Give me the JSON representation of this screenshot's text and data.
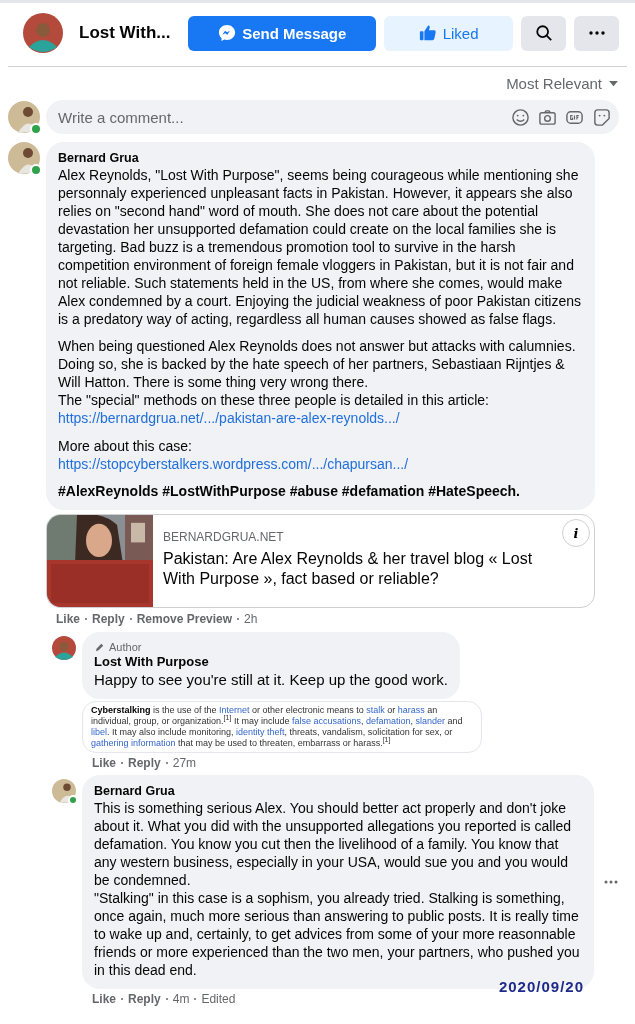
{
  "header": {
    "page_name": "Lost With...",
    "buttons": [
      {
        "label": "Send Message",
        "kind": "primary"
      },
      {
        "label": "Liked",
        "kind": "liked"
      },
      {
        "kind": "search"
      },
      {
        "kind": "more"
      }
    ]
  },
  "sort": {
    "label": "Most Relevant"
  },
  "composer": {
    "placeholder": "Write a comment...",
    "online": true
  },
  "comment": {
    "author": "Bernard Grua",
    "online": true,
    "paragraphs": [
      {
        "lines": [
          {
            "kind": "text",
            "text": "Alex Reynolds, \"Lost With Purpose\", seems being courageous while mentioning she personnaly experienced unpleasant facts in Pakistan. However, it appears she also relies on \"second hand\" word of mouth. She does not care about the potential devastation her unsupported defamation could create on the local families she is targeting. Bad buzz is a tremendous promotion tool to survive in the harsh competition environment of foreign female vloggers in Pakistan, but it is not fair and not reliable. Such statements held in the US, from where she comes, would make Alex condemned by a court. Enjoying the judicial weakness of poor Pakistan citizens is a predatory way of acting, regardless all human causes showed as false flags."
          }
        ]
      },
      {
        "lines": [
          {
            "kind": "text",
            "text": "When being questioned Alex Reynolds does not answer but attacks with calumnies. Doing so, she is backed by the hate speech of her partners, Sebastiaan Rijntjes & Will Hatton. There is some thing very wrong there."
          },
          {
            "kind": "text",
            "text": "The \"special\" methods on these three people is detailed in this article:"
          },
          {
            "kind": "link",
            "text": "https://bernardgrua.net/.../pakistan-are-alex-reynolds.../"
          }
        ]
      },
      {
        "lines": [
          {
            "kind": "text",
            "text": "More about this case:"
          },
          {
            "kind": "link",
            "text": "https://stopcyberstalkers.wordpress.com/.../chapursan.../"
          }
        ]
      },
      {
        "lines": [
          {
            "kind": "hashtags",
            "text": "#AlexReynolds #LostWithPurpose #abuse #defamation #HateSpeech."
          }
        ]
      }
    ],
    "preview": {
      "kind": "picture",
      "domain": "BERNARDGRUA.NET",
      "title": "Pakistan: Are Alex Reynolds & her travel blog « Lost With Purpose », fact based or reliable?",
      "info": "i"
    },
    "actions": [
      {
        "label": "Like",
        "kind": "link"
      },
      {
        "label": "Reply",
        "kind": "link"
      },
      {
        "label": "Remove Preview",
        "kind": "link"
      },
      {
        "label": "2h",
        "kind": "meta"
      }
    ]
  },
  "replies": [
    {
      "badge": "Author",
      "author": "Lost With Purpose",
      "online": false,
      "big_text": true,
      "lines": [
        "Happy to see you're still at it. Keep up the good work."
      ],
      "attachment": [
        {
          "kind": "bold",
          "text": "Cyberstalking"
        },
        {
          "kind": "text",
          "text": " is the use of the "
        },
        {
          "kind": "link",
          "text": "Internet"
        },
        {
          "kind": "text",
          "text": " or other electronic means to "
        },
        {
          "kind": "link",
          "text": "stalk"
        },
        {
          "kind": "text",
          "text": " or "
        },
        {
          "kind": "link",
          "text": "harass"
        },
        {
          "kind": "text",
          "text": " an individual, group, or organization.$^{[1]}$ It may include "
        },
        {
          "kind": "link",
          "text": "false accusations"
        },
        {
          "kind": "text",
          "text": ", "
        },
        {
          "kind": "link",
          "text": "defamation"
        },
        {
          "kind": "text",
          "text": ", "
        },
        {
          "kind": "link",
          "text": "slander"
        },
        {
          "kind": "text",
          "text": " and "
        },
        {
          "kind": "link",
          "text": "libel"
        },
        {
          "kind": "text",
          "text": ". It may also include monitoring, "
        },
        {
          "kind": "link",
          "text": "identity theft"
        },
        {
          "kind": "text",
          "text": ", threats, vandalism, solicitation for sex, or "
        },
        {
          "kind": "link",
          "text": "gathering information"
        },
        {
          "kind": "text",
          "text": " that may be used to threaten, embarrass or harass.$^{[1]}$"
        }
      ],
      "actions": [
        {
          "label": "Like",
          "kind": "link"
        },
        {
          "label": "Reply",
          "kind": "link"
        },
        {
          "label": "27m",
          "kind": "meta"
        }
      ],
      "more": false
    },
    {
      "author": "Bernard Grua",
      "online": true,
      "big_text": false,
      "lines": [
        "This is something serious Alex. You should better act properly and don't joke about it. What you did with the unsupported allegations you reported is called defamation. You know you cut then the livelihood of a family. You know that any western business, especially in your USA, would sue you and you would be condemned.",
        "\"Stalking\" in this case is a sophism, you already tried. Stalking is something, once again, much more serious than answering to public posts. It is really time to wake up and, certainly, to get advices from some of your more reasonnable friends or more experienced than the two men, your partners, who pushed you in this dead end."
      ],
      "stamp": "2020/09/20",
      "actions": [
        {
          "label": "Like",
          "kind": "link"
        },
        {
          "label": "Reply",
          "kind": "link"
        },
        {
          "label": "4m",
          "kind": "meta"
        },
        {
          "label": "Edited",
          "kind": "meta"
        }
      ],
      "more": true
    }
  ]
}
